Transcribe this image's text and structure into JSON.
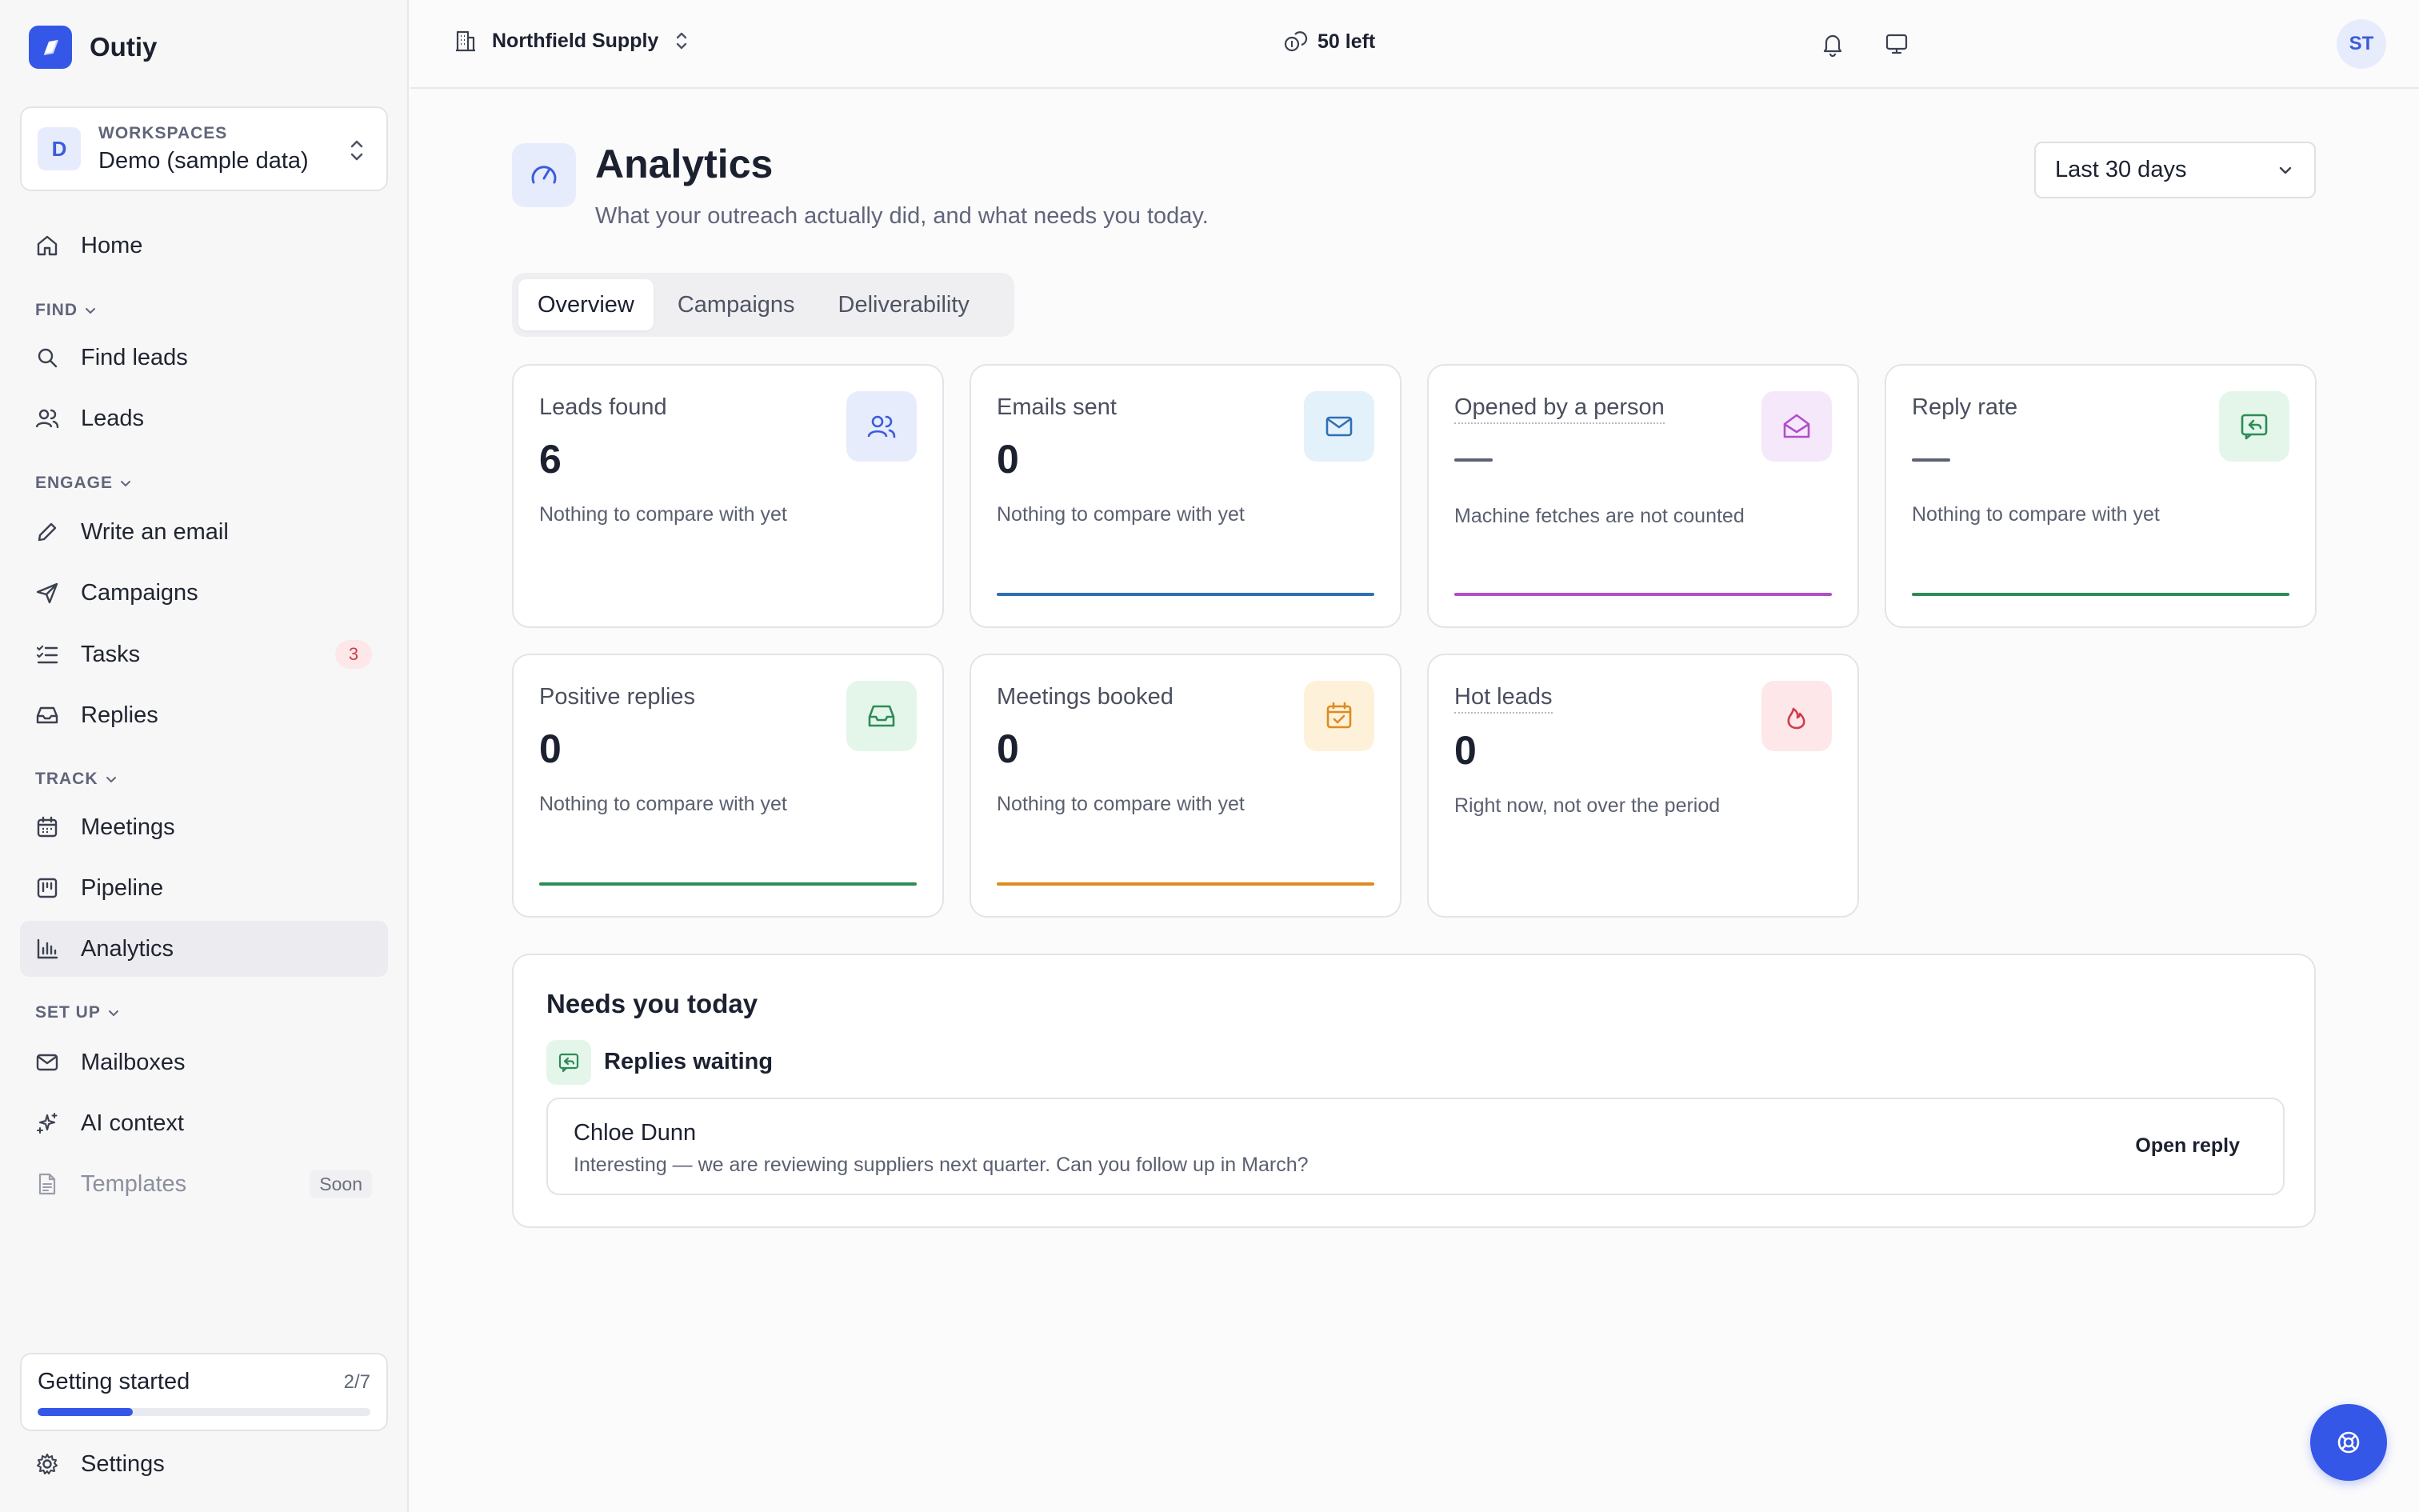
{
  "brand": {
    "name": "Outiy"
  },
  "workspace": {
    "label": "WORKSPACES",
    "name": "Demo (sample data)",
    "initial": "D"
  },
  "nav": {
    "home": "Home",
    "find_header": "FIND",
    "find_leads": "Find leads",
    "leads": "Leads",
    "engage_header": "ENGAGE",
    "write_email": "Write an email",
    "campaigns": "Campaigns",
    "tasks": "Tasks",
    "tasks_badge": "3",
    "replies": "Replies",
    "track_header": "TRACK",
    "meetings": "Meetings",
    "pipeline": "Pipeline",
    "analytics": "Analytics",
    "setup_header": "SET UP",
    "mailboxes": "Mailboxes",
    "ai_context": "AI context",
    "templates": "Templates",
    "templates_badge": "Soon",
    "settings": "Settings"
  },
  "getting_started": {
    "title": "Getting started",
    "count": "2/7",
    "progress": 0.2857
  },
  "topbar": {
    "org": "Northfield Supply",
    "credits": "50 left",
    "user_initials": "ST"
  },
  "page": {
    "title": "Analytics",
    "subtitle": "What your outreach actually did, and what needs you today.",
    "range": "Last 30 days",
    "tabs": [
      "Overview",
      "Campaigns",
      "Deliverability"
    ]
  },
  "stats": [
    {
      "label": "Leads found",
      "value": "6",
      "note": "Nothing to compare with yet",
      "icon": "users-icon"
    },
    {
      "label": "Emails sent",
      "value": "0",
      "note": "Nothing to compare with yet",
      "icon": "mail-icon",
      "line_color": "#2f6fb5"
    },
    {
      "label": "Opened by a person",
      "value": "",
      "note": "Machine fetches are not counted",
      "icon": "mail-open-icon",
      "line_color": "#b04fc9"
    },
    {
      "label": "Reply rate",
      "value": "",
      "note": "Nothing to compare with yet",
      "icon": "reply-icon",
      "line_color": "#2e8b57"
    },
    {
      "label": "Positive replies",
      "value": "0",
      "note": "Nothing to compare with yet",
      "icon": "inbox-icon",
      "line_color": "#2e8b57"
    },
    {
      "label": "Meetings booked",
      "value": "0",
      "note": "Nothing to compare with yet",
      "icon": "calendar-check-icon",
      "line_color": "#e08a1e"
    },
    {
      "label": "Hot leads",
      "value": "0",
      "note": "Right now, not over the period",
      "icon": "flame-icon"
    }
  ],
  "needs": {
    "title": "Needs you today",
    "section": "Replies waiting",
    "reply": {
      "name": "Chloe Dunn",
      "text": "Interesting — we are reviewing suppliers next quarter. Can you follow up in March?",
      "action": "Open reply"
    }
  }
}
